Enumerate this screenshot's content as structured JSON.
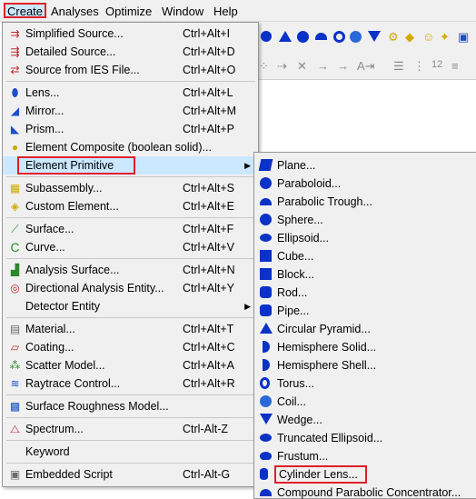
{
  "menubar": {
    "items": [
      "Create",
      "Analyses",
      "Optimize",
      "Window",
      "Help"
    ]
  },
  "create_menu": {
    "items": [
      {
        "label": "Simplified Source...",
        "shortcut": "Ctrl+Alt+I",
        "icon": "simplified-source-icon"
      },
      {
        "label": "Detailed Source...",
        "shortcut": "Ctrl+Alt+D",
        "icon": "detailed-source-icon"
      },
      {
        "label": "Source from IES File...",
        "shortcut": "Ctrl+Alt+O",
        "icon": "ies-source-icon"
      },
      {
        "label": "Lens...",
        "shortcut": "Ctrl+Alt+L",
        "icon": "lens-icon"
      },
      {
        "label": "Mirror...",
        "shortcut": "Ctrl+Alt+M",
        "icon": "mirror-icon"
      },
      {
        "label": "Prism...",
        "shortcut": "Ctrl+Alt+P",
        "icon": "prism-icon"
      },
      {
        "label": "Element Composite (boolean solid)...",
        "shortcut": "",
        "icon": "element-composite-icon"
      },
      {
        "label": "Element Primitive",
        "shortcut": "",
        "icon": ""
      },
      {
        "label": "Subassembly...",
        "shortcut": "Ctrl+Alt+S",
        "icon": "subassembly-icon"
      },
      {
        "label": "Custom Element...",
        "shortcut": "Ctrl+Alt+E",
        "icon": "custom-element-icon"
      },
      {
        "label": "Surface...",
        "shortcut": "Ctrl+Alt+F",
        "icon": "surface-icon"
      },
      {
        "label": "Curve...",
        "shortcut": "Ctrl+Alt+V",
        "icon": "curve-icon"
      },
      {
        "label": "Analysis Surface...",
        "shortcut": "Ctrl+Alt+N",
        "icon": "analysis-surface-icon"
      },
      {
        "label": "Directional Analysis Entity...",
        "shortcut": "Ctrl+Alt+Y",
        "icon": "directional-analysis-icon"
      },
      {
        "label": "Detector Entity",
        "shortcut": "",
        "icon": ""
      },
      {
        "label": "Material...",
        "shortcut": "Ctrl+Alt+T",
        "icon": "material-icon"
      },
      {
        "label": "Coating...",
        "shortcut": "Ctrl+Alt+C",
        "icon": "coating-icon"
      },
      {
        "label": "Scatter Model...",
        "shortcut": "Ctrl+Alt+A",
        "icon": "scatter-model-icon"
      },
      {
        "label": "Raytrace Control...",
        "shortcut": "Ctrl+Alt+R",
        "icon": "raytrace-control-icon"
      },
      {
        "label": "Surface Roughness Model...",
        "shortcut": "",
        "icon": "surface-roughness-icon"
      },
      {
        "label": "Spectrum...",
        "shortcut": "Ctrl-Alt-Z",
        "icon": "spectrum-icon"
      },
      {
        "label": "Keyword",
        "shortcut": "",
        "icon": ""
      },
      {
        "label": "Embedded Script",
        "shortcut": "Ctrl-Alt-G",
        "icon": "embedded-script-icon"
      }
    ]
  },
  "primitive_submenu": {
    "items": [
      {
        "label": "Plane...",
        "icon": "plane-icon"
      },
      {
        "label": "Paraboloid...",
        "icon": "paraboloid-icon"
      },
      {
        "label": "Parabolic Trough...",
        "icon": "parabolic-trough-icon"
      },
      {
        "label": "Sphere...",
        "icon": "sphere-icon"
      },
      {
        "label": "Ellipsoid...",
        "icon": "ellipsoid-icon"
      },
      {
        "label": "Cube...",
        "icon": "cube-icon"
      },
      {
        "label": "Block...",
        "icon": "block-icon"
      },
      {
        "label": "Rod...",
        "icon": "rod-icon"
      },
      {
        "label": "Pipe...",
        "icon": "pipe-icon"
      },
      {
        "label": "Circular Pyramid...",
        "icon": "circular-pyramid-icon"
      },
      {
        "label": "Hemisphere Solid...",
        "icon": "hemisphere-solid-icon"
      },
      {
        "label": "Hemisphere Shell...",
        "icon": "hemisphere-shell-icon"
      },
      {
        "label": "Torus...",
        "icon": "torus-icon"
      },
      {
        "label": "Coil...",
        "icon": "coil-icon"
      },
      {
        "label": "Wedge...",
        "icon": "wedge-icon"
      },
      {
        "label": "Truncated Ellipsoid...",
        "icon": "truncated-ellipsoid-icon"
      },
      {
        "label": "Frustum...",
        "icon": "frustum-icon"
      },
      {
        "label": "Cylinder Lens...",
        "icon": "cylinder-lens-icon"
      },
      {
        "label": "Compound Parabolic Concentrator...",
        "icon": "compound-parabolic-concentrator-icon"
      }
    ]
  },
  "toolbar": {
    "row2_text": "12"
  },
  "colors": {
    "highlight": "#cce8ff",
    "annotation_red": "#e0202a",
    "primitive_blue": "#0a32c8",
    "menu_bg": "#f0f0f0"
  }
}
